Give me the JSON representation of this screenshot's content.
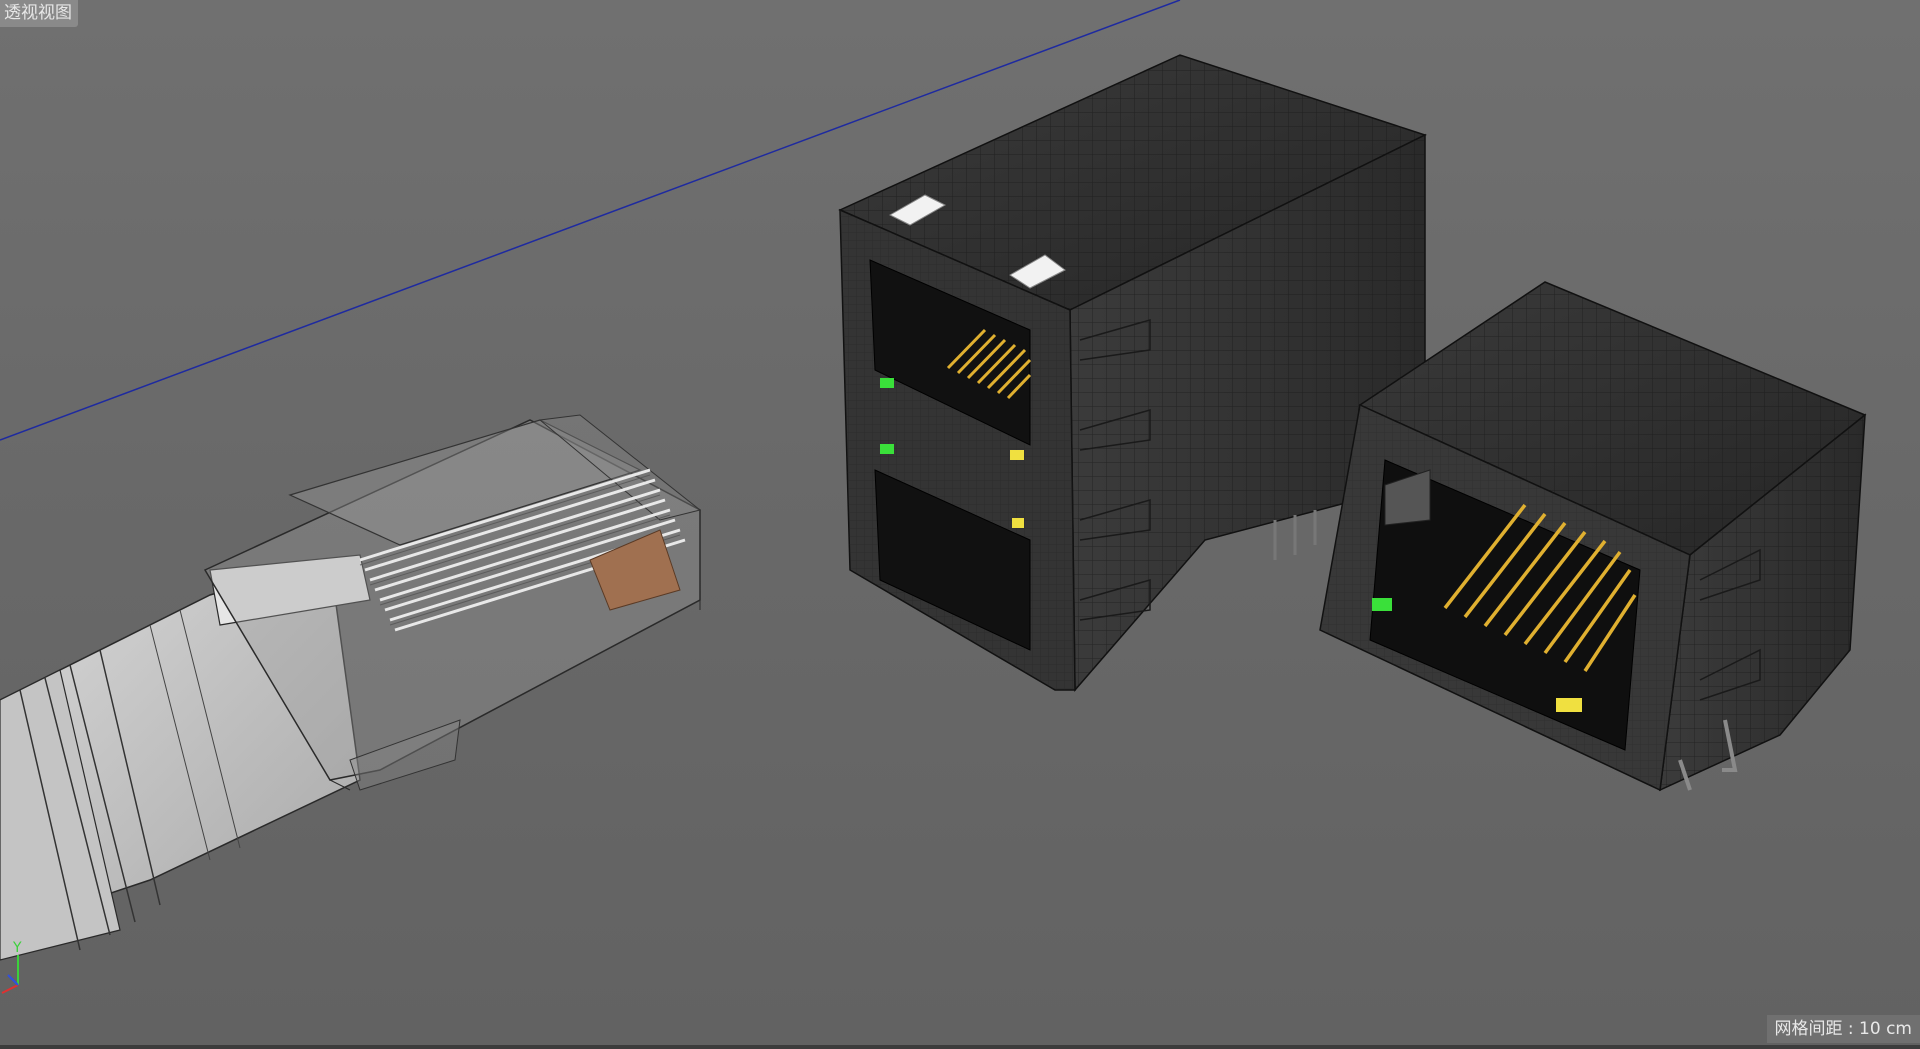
{
  "viewport": {
    "view_label": "透视视图",
    "grid_spacing_label": "网格间距 : 10 cm",
    "axes": {
      "y_label": "Y"
    }
  },
  "objects": [
    {
      "name": "rj45-plug",
      "description_visible": false
    },
    {
      "name": "stacked-rj45-jack"
    },
    {
      "name": "single-rj45-jack"
    }
  ],
  "colors": {
    "background": "#6b6b6b",
    "jack_body": "#2d2d2d",
    "wire": "#1a1a1a",
    "pins": "#e0b030",
    "led_green": "#3ae03a",
    "led_yellow": "#f0e040",
    "horizon_line": "#1e2aa0"
  }
}
